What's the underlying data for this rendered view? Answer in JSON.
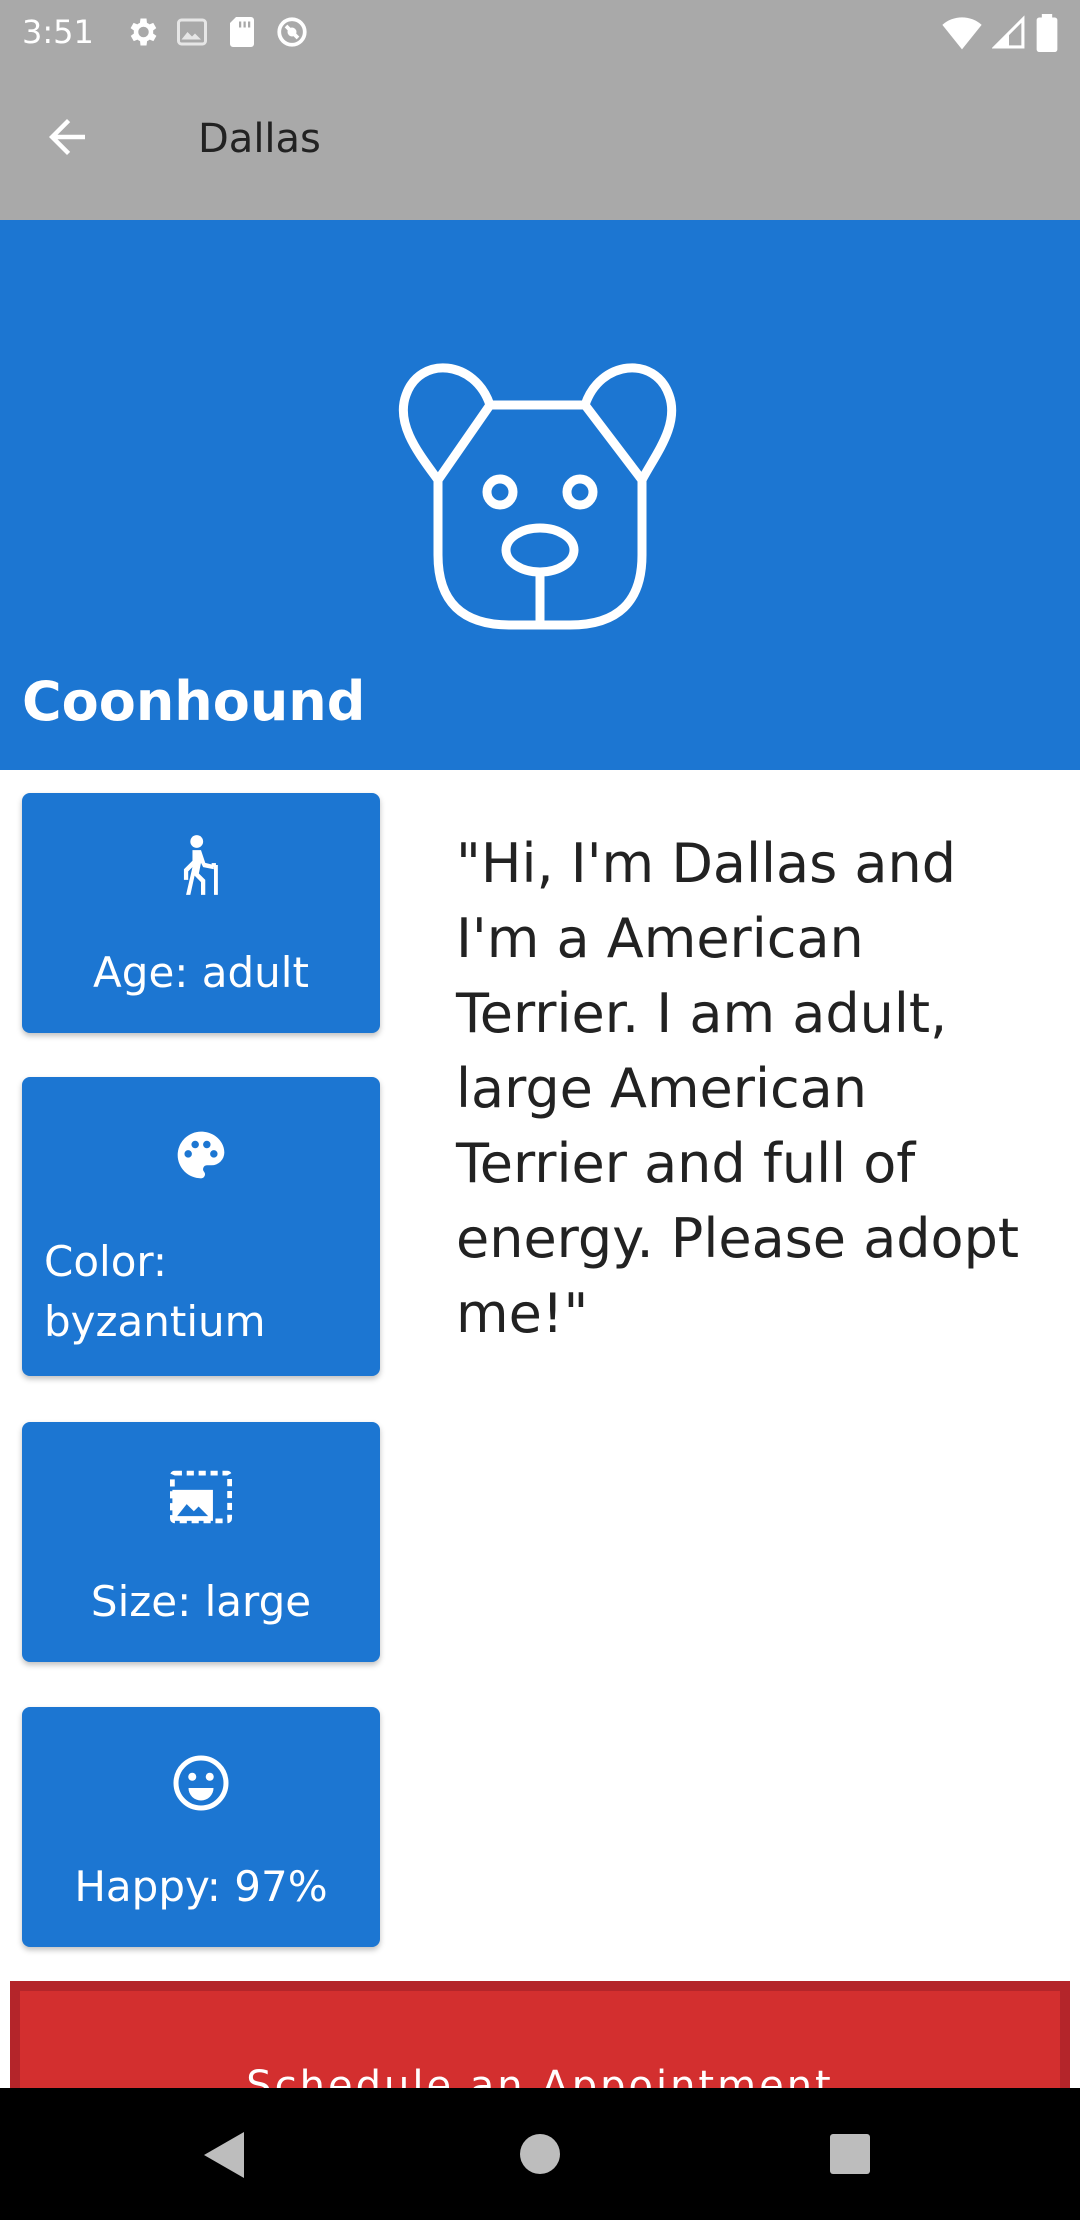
{
  "status_bar": {
    "time": "3:51",
    "left_icons": [
      "settings-icon",
      "image-icon",
      "sd-card-icon",
      "sync-icon"
    ],
    "right_icons": [
      "wifi-icon",
      "signal-icon",
      "battery-icon"
    ]
  },
  "app_bar": {
    "title": "Dallas"
  },
  "hero": {
    "breed": "Coonhound",
    "icon": "dog-face-icon",
    "background": "#1c76d2"
  },
  "cards": {
    "age": {
      "label": "Age: adult",
      "icon": "elderly-person-icon"
    },
    "color": {
      "label": "Color: byzantium",
      "icon": "palette-icon"
    },
    "size": {
      "label": "Size: large",
      "icon": "photo-size-icon"
    },
    "happy": {
      "label": "Happy: 97%",
      "icon": "smiley-face-icon"
    }
  },
  "description": "\"Hi, I'm Dallas and I'm a American Terrier. I am adult, large American Terrier and full of energy. Please adopt me!\"",
  "schedule_button": {
    "label": "Schedule an Appointment",
    "color": "#d32f2f"
  },
  "nav_bar": {
    "icons": [
      "back-triangle-icon",
      "home-circle-icon",
      "recents-square-icon"
    ]
  }
}
